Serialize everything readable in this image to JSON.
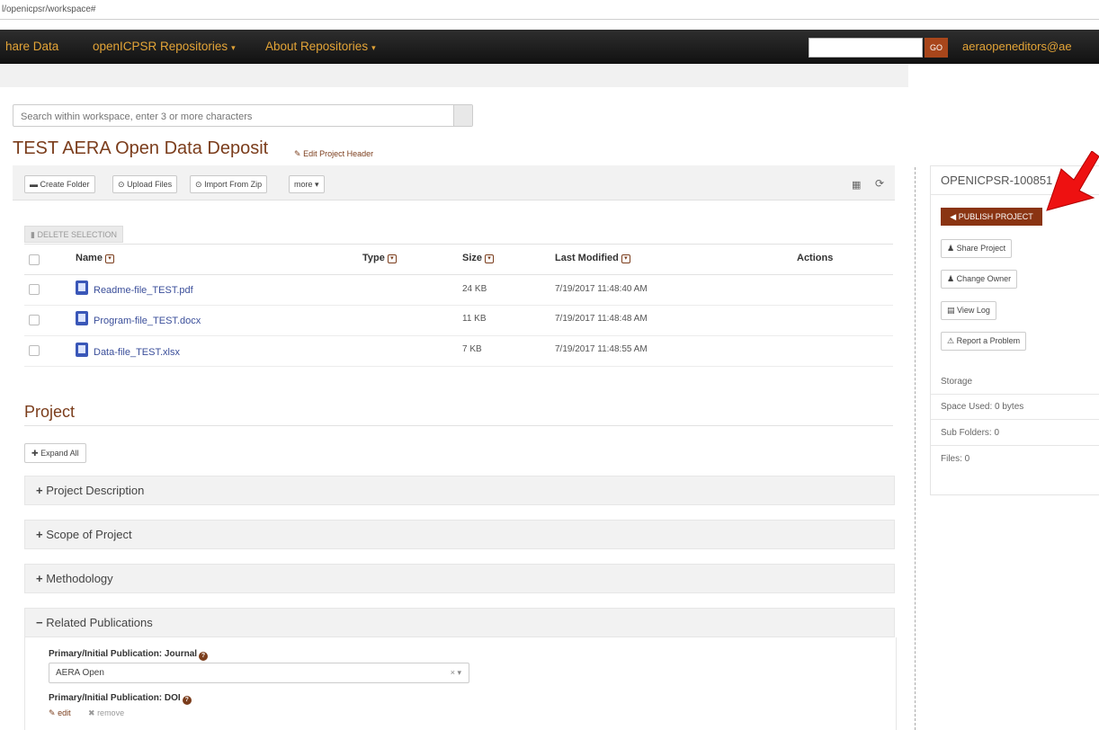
{
  "browser": {
    "url": "l/openicpsr/workspace#"
  },
  "nav": {
    "items": [
      {
        "label": "hare Data"
      },
      {
        "label": "openICPSR Repositories",
        "caret": "▾"
      },
      {
        "label": "About Repositories",
        "caret": "▾"
      }
    ],
    "search_value": "",
    "go_label": "GO",
    "user": "aeraopeneditors@ae"
  },
  "workspace_search": {
    "placeholder": "Search within workspace, enter 3 or more characters"
  },
  "project": {
    "title": "TEST AERA Open Data Deposit",
    "edit_header": "Edit Project Header"
  },
  "toolbar": {
    "create_folder": "Create Folder",
    "upload_files": "Upload Files",
    "import_zip": "Import From Zip",
    "more": "more ▾"
  },
  "delete_selection": "DELETE SELECTION",
  "table": {
    "headers": {
      "name": "Name",
      "type": "Type",
      "size": "Size",
      "modified": "Last Modified",
      "actions": "Actions"
    },
    "rows": [
      {
        "name": "Readme-file_TEST.pdf",
        "size": "24 KB",
        "modified": "7/19/2017 11:48:40 AM"
      },
      {
        "name": "Program-file_TEST.docx",
        "size": "11 KB",
        "modified": "7/19/2017 11:48:48 AM"
      },
      {
        "name": "Data-file_TEST.xlsx",
        "size": "7 KB",
        "modified": "7/19/2017 11:48:55 AM"
      }
    ]
  },
  "section": {
    "title": "Project",
    "expand_all": "Expand All",
    "accordions": [
      {
        "label": "Project Description",
        "sign": "+"
      },
      {
        "label": "Scope of Project",
        "sign": "+"
      },
      {
        "label": "Methodology",
        "sign": "+"
      },
      {
        "label": "Related Publications",
        "sign": "−"
      }
    ],
    "journal_label": "Primary/Initial Publication: Journal",
    "journal_value": "AERA Open",
    "doi_label": "Primary/Initial Publication: DOI",
    "edit": "edit",
    "remove": "remove"
  },
  "sidebar": {
    "project_id": "OPENICPSR-100851",
    "publish": "PUBLISH PROJECT",
    "share": "Share Project",
    "change_owner": "Change Owner",
    "view_log": "View Log",
    "report": "Report a Problem",
    "storage_label": "Storage",
    "space_used": "Space Used: 0 bytes",
    "sub_folders": "Sub Folders: 0",
    "files": "Files: 0"
  },
  "colors": {
    "brand": "#7b3d1c",
    "nav_text": "#e3a437",
    "publish_bg": "#8a3412",
    "annotation": "#ee1111"
  }
}
